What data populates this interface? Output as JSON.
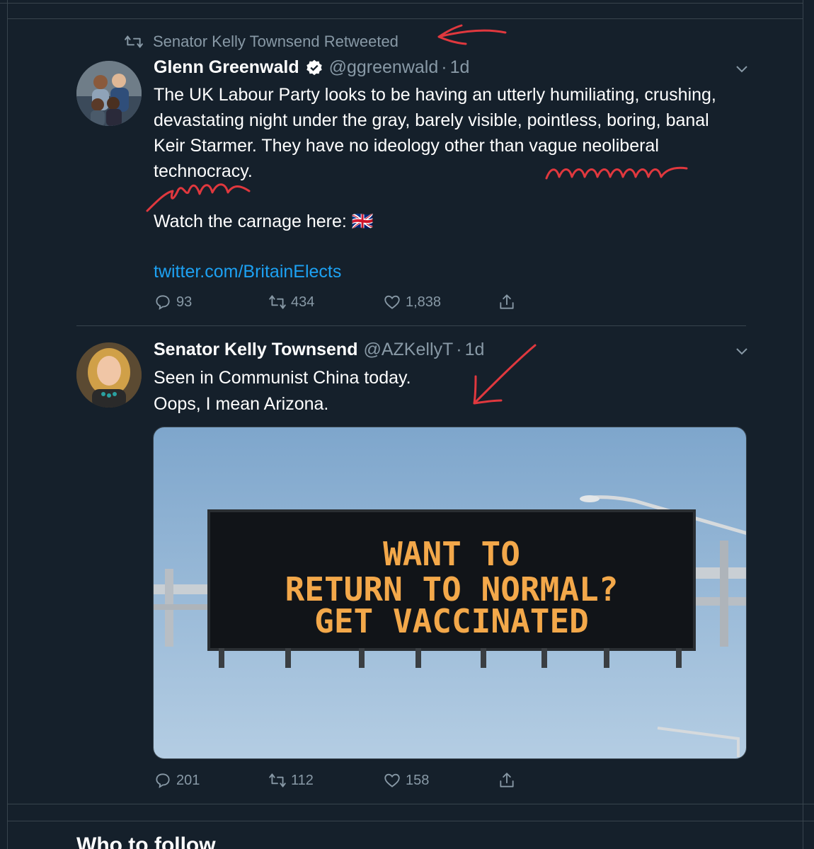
{
  "retweet": {
    "label": "Senator Kelly Townsend Retweeted"
  },
  "tweet1": {
    "name": "Glenn Greenwald",
    "handle": "@ggreenwald",
    "time": "1d",
    "body_line1": "The UK Labour Party looks to be having an utterly humiliating, crushing,",
    "body_line2": "devastating night under the gray, barely visible, pointless, boring, banal",
    "body_line3": "Keir Starmer. They have no ideology other than vague neoliberal",
    "body_line4": "technocracy.",
    "body_line5": "Watch the carnage here:",
    "flag": "🇬🇧",
    "link": "twitter.com/BritainElects",
    "replies": "93",
    "retweets": "434",
    "likes": "1,838"
  },
  "tweet2": {
    "name": "Senator Kelly Townsend",
    "handle": "@AZKellyT",
    "time": "1d",
    "body_line1": "Seen in Communist China today.",
    "body_line2": "Oops, I mean Arizona.",
    "sign_line1": "WANT TO",
    "sign_line2": "RETURN TO NORMAL?",
    "sign_line3": "GET VACCINATED",
    "replies": "201",
    "retweets": "112",
    "likes": "158"
  },
  "sidebar": {
    "who_to_follow": "Who to follow"
  },
  "colors": {
    "background": "#15202b",
    "link": "#1da1f2",
    "muted": "#8899a6",
    "annotation": "#e0383e"
  },
  "icons": [
    "retweet-icon",
    "verified-icon",
    "chevron-down-icon",
    "reply-icon",
    "like-icon",
    "share-icon"
  ]
}
